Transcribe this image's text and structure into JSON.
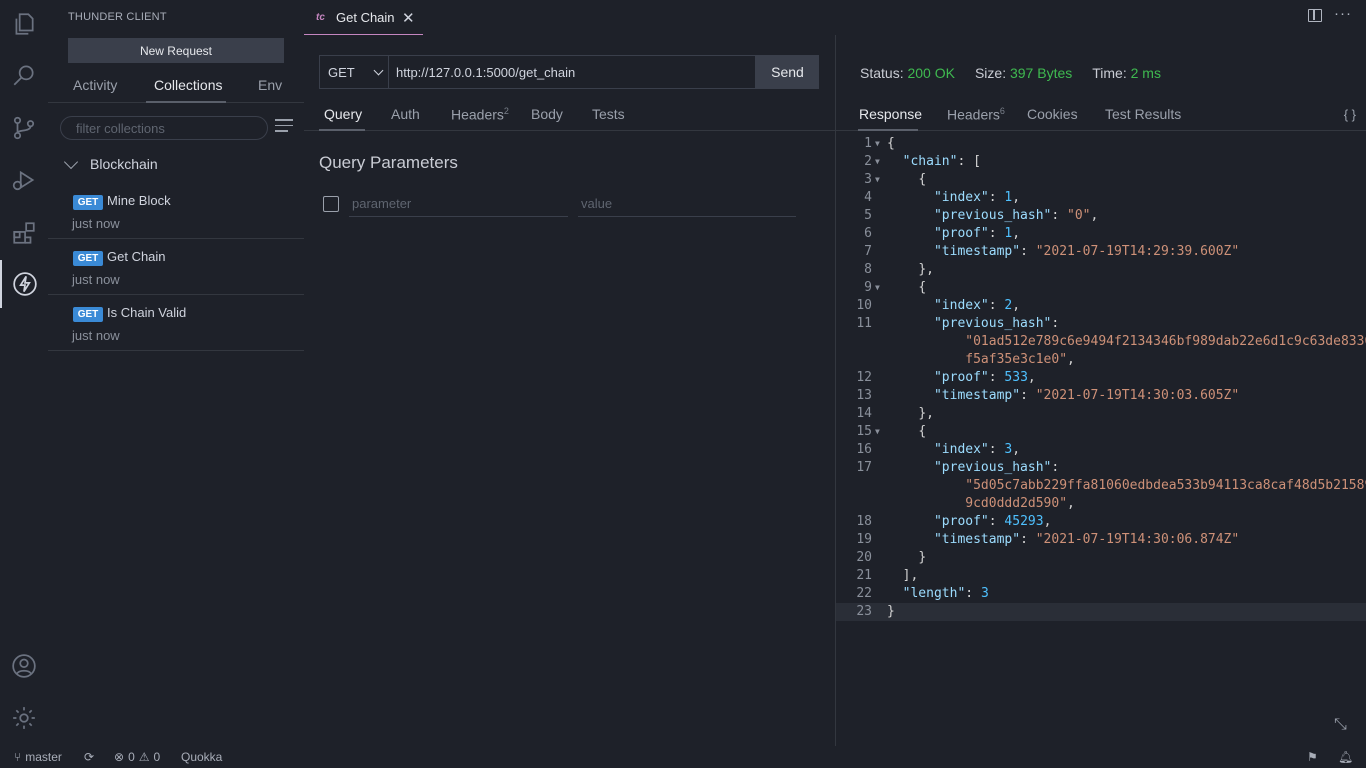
{
  "sidebar": {
    "title": "THUNDER CLIENT",
    "new_request": "New Request",
    "tabs": [
      "Activity",
      "Collections",
      "Env"
    ],
    "filter_placeholder": "filter collections",
    "collection": "Blockchain",
    "requests": [
      {
        "method": "GET",
        "name": "Mine Block",
        "time": "just now"
      },
      {
        "method": "GET",
        "name": "Get Chain",
        "time": "just now"
      },
      {
        "method": "GET",
        "name": "Is Chain Valid",
        "time": "just now"
      }
    ]
  },
  "editor": {
    "tab_prefix": "tc",
    "tab_label": "Get Chain",
    "tab_close": "✕"
  },
  "request": {
    "method": "GET",
    "url": "http://127.0.0.1:5000/get_chain",
    "send": "Send",
    "tabs": {
      "query": "Query",
      "auth": "Auth",
      "headers": "Headers",
      "headers_count": "2",
      "body": "Body",
      "tests": "Tests"
    },
    "query_title": "Query Parameters",
    "param_placeholder": "parameter",
    "value_placeholder": "value"
  },
  "response": {
    "status_label": "Status:",
    "status_value": "200 OK",
    "size_label": "Size:",
    "size_value": "397 Bytes",
    "time_label": "Time:",
    "time_value": "2 ms",
    "tabs": {
      "response": "Response",
      "headers": "Headers",
      "headers_count": "6",
      "cookies": "Cookies",
      "results": "Test Results"
    },
    "braces": "{ }"
  },
  "statusbar": {
    "branch": "master",
    "errors": "0",
    "warnings": "0",
    "extension": "Quokka"
  },
  "colors": {
    "accent_tab": "#c586c0",
    "status_ok": "#3fb950",
    "get_badge": "#3a8ad6"
  }
}
